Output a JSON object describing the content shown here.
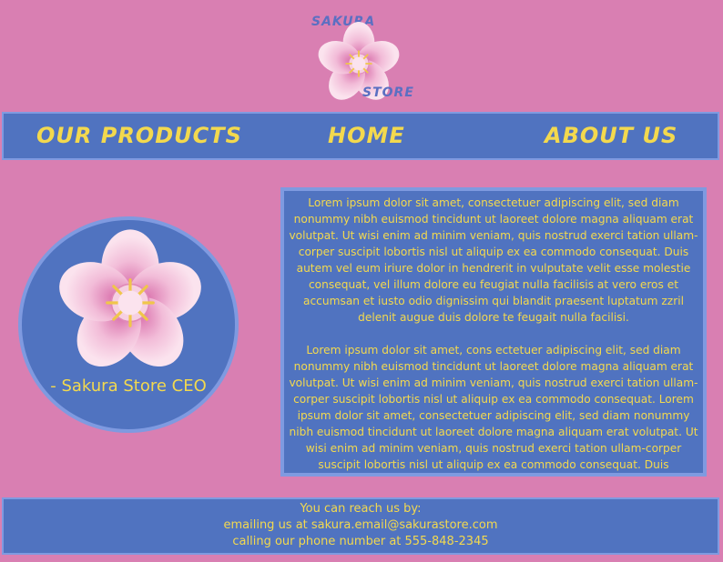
{
  "logo": {
    "word_top": "SAKURA",
    "word_bottom": "STORE",
    "icon": "cherry-blossom-icon"
  },
  "nav": {
    "products": "OUR PRODUCTS",
    "home": "HOME",
    "about": "ABOUT US"
  },
  "ceo": {
    "caption": "- Sakura Store CEO",
    "icon": "cherry-blossom-icon"
  },
  "panel": {
    "paragraph1": "Lorem ipsum dolor sit amet, consectetuer adipiscing elit, sed diam nonummy nibh euismod tincidunt ut laoreet dolore magna aliquam erat volutpat. Ut wisi enim ad minim veniam, quis nostrud exerci tation ullam-corper suscipit lobortis nisl ut aliquip ex ea commodo consequat. Duis autem vel eum iriure dolor in hendrerit in vulputate velit esse molestie consequat, vel illum dolore eu feugiat nulla facilisis at vero eros et accumsan et iusto odio dignissim qui blandit praesent luptatum zzril delenit augue duis dolore te feugait nulla facilisi.",
    "paragraph2": "Lorem ipsum dolor sit amet, cons ectetuer adipiscing elit, sed diam nonummy nibh euismod tincidunt ut laoreet dolore magna aliquam erat volutpat. Ut wisi enim ad minim veniam, quis nostrud exerci tation ullam-corper suscipit lobortis nisl ut aliquip ex ea commodo consequat. Lorem ipsum dolor sit amet, consectetuer adipiscing elit, sed diam nonummy nibh euismod tincidunt ut laoreet dolore magna aliquam erat volutpat. Ut wisi enim ad minim veniam, quis nostrud exerci tation ullam-corper suscipit lobortis nisl ut aliquip ex ea commodo consequat. Duis"
  },
  "footer": {
    "line1": "You can reach us by:",
    "line2": "emailing us at sakura.email@sakurastore.com",
    "line3": "calling our phone number at 555-848-2345"
  },
  "colors": {
    "background": "#d97fb2",
    "panel": "#5073c0",
    "border": "#7f9ae0",
    "text": "#f3d94e",
    "petal": "#f3c3dc"
  }
}
